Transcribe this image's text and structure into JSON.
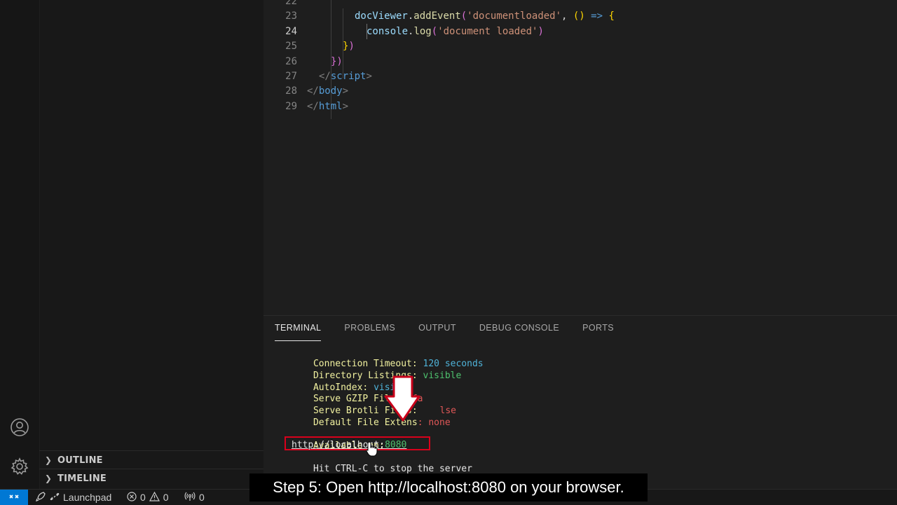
{
  "editor": {
    "active_line": "24",
    "lines": [
      {
        "num": "22",
        "parts": [
          {
            "cls": "t-punc",
            "text": ""
          }
        ]
      },
      {
        "num": "23",
        "parts": [
          {
            "cls": "t-ident",
            "text": "docViewer"
          },
          {
            "cls": "t-punc",
            "text": "."
          },
          {
            "cls": "t-fn",
            "text": "addEvent"
          },
          {
            "cls": "t-brace2",
            "text": "("
          },
          {
            "cls": "t-str",
            "text": "'documentloaded'"
          },
          {
            "cls": "t-punc",
            "text": ", "
          },
          {
            "cls": "t-brace",
            "text": "()"
          },
          {
            "cls": "t-kw",
            "text": " => "
          },
          {
            "cls": "t-brace",
            "text": "{"
          }
        ]
      },
      {
        "num": "24",
        "parts": [
          {
            "cls": "t-ident",
            "text": "console"
          },
          {
            "cls": "t-punc",
            "text": "."
          },
          {
            "cls": "t-fn",
            "text": "log"
          },
          {
            "cls": "t-brace2",
            "text": "("
          },
          {
            "cls": "t-str",
            "text": "'document loaded'"
          },
          {
            "cls": "t-brace2",
            "text": ")"
          }
        ]
      },
      {
        "num": "25",
        "parts": [
          {
            "cls": "t-brace",
            "text": "}"
          },
          {
            "cls": "t-brace2",
            "text": ")"
          }
        ]
      },
      {
        "num": "26",
        "parts": [
          {
            "cls": "t-brace2",
            "text": "})"
          }
        ]
      },
      {
        "num": "27",
        "parts": [
          {
            "cls": "t-tag",
            "text": "</"
          },
          {
            "cls": "t-tagname",
            "text": "script"
          },
          {
            "cls": "t-tag",
            "text": ">"
          }
        ]
      },
      {
        "num": "28",
        "parts": [
          {
            "cls": "t-tag",
            "text": "</"
          },
          {
            "cls": "t-tagname",
            "text": "body"
          },
          {
            "cls": "t-tag",
            "text": ">"
          }
        ]
      },
      {
        "num": "29",
        "parts": [
          {
            "cls": "t-tag",
            "text": "</"
          },
          {
            "cls": "t-tagname",
            "text": "html"
          },
          {
            "cls": "t-tag",
            "text": ">"
          }
        ]
      }
    ]
  },
  "panel": {
    "tabs": [
      "TERMINAL",
      "PROBLEMS",
      "OUTPUT",
      "DEBUG CONSOLE",
      "PORTS"
    ],
    "active_tab": "TERMINAL",
    "terminal": {
      "lines": [
        {
          "key": "Connection Timeout: ",
          "value": "120 seconds",
          "value_color": "cyan"
        },
        {
          "key": "Directory Listings: ",
          "value": "visible",
          "value_color": "green"
        },
        {
          "key": "AutoIndex: ",
          "value": "visible",
          "value_color": "cyan"
        },
        {
          "key": "Serve GZIP Files: ",
          "value": "fa",
          "value_color": "red"
        },
        {
          "key": "Serve Brotli Files: ",
          "value": "lse",
          "value_color": "red"
        },
        {
          "key": "Default File Extens",
          "value": ": none",
          "value_color": "red"
        }
      ],
      "available_label": "Available on:",
      "url_host": "http://localhost:",
      "url_port": "8080",
      "hint": "Hit CTRL-C to stop the server"
    }
  },
  "sidebar": {
    "sections": [
      {
        "label": "OUTLINE"
      },
      {
        "label": "TIMELINE"
      }
    ]
  },
  "statusbar": {
    "launchpad": "Launchpad",
    "errors": "0",
    "warnings": "0",
    "ports": "0"
  },
  "caption": "Step 5: Open http://localhost:8080 on your browser.",
  "colors": {
    "accent": "#0078d4",
    "highlight_box": "#d9001b",
    "arrow": "#ffffff"
  }
}
